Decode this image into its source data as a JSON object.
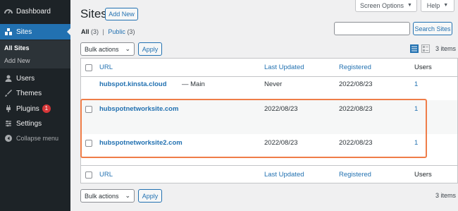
{
  "sidebar": {
    "items": [
      {
        "label": "Dashboard",
        "icon": "dashboard-icon"
      },
      {
        "label": "Sites",
        "icon": "sites-icon",
        "active": true
      },
      {
        "label": "Users",
        "icon": "users-icon"
      },
      {
        "label": "Themes",
        "icon": "themes-icon"
      },
      {
        "label": "Plugins",
        "icon": "plugins-icon",
        "badge": "1"
      },
      {
        "label": "Settings",
        "icon": "settings-icon"
      },
      {
        "label": "Collapse menu",
        "icon": "collapse-icon"
      }
    ],
    "submenu": [
      "All Sites",
      "Add New"
    ]
  },
  "header": {
    "title": "Sites",
    "add_new": "Add New",
    "screen_options": "Screen Options",
    "help": "Help"
  },
  "filters": {
    "all": "All",
    "all_count": "(3)",
    "separator": "|",
    "public": "Public",
    "public_count": "(3)"
  },
  "search": {
    "placeholder": "",
    "button": "Search Sites"
  },
  "bulk": {
    "label": "Bulk actions",
    "apply": "Apply"
  },
  "items_count": "3 items",
  "table": {
    "headers": [
      "URL",
      "Last Updated",
      "Registered",
      "Users"
    ],
    "rows": [
      {
        "url": "hubspot.kinsta.cloud",
        "suffix": "— Main",
        "last_updated": "Never",
        "registered": "2022/08/23",
        "users": "1"
      },
      {
        "url": "hubspotnetworksite.com",
        "suffix": "",
        "last_updated": "2022/08/23",
        "registered": "2022/08/23",
        "users": "1"
      },
      {
        "url": "hubspotnetworksite2.com",
        "suffix": "",
        "last_updated": "2022/08/23",
        "registered": "2022/08/23",
        "users": "1"
      }
    ]
  },
  "colors": {
    "accent": "#2271b1",
    "sidebar": "#1d2327",
    "highlight": "#ef7d48",
    "badge": "#d63638"
  }
}
